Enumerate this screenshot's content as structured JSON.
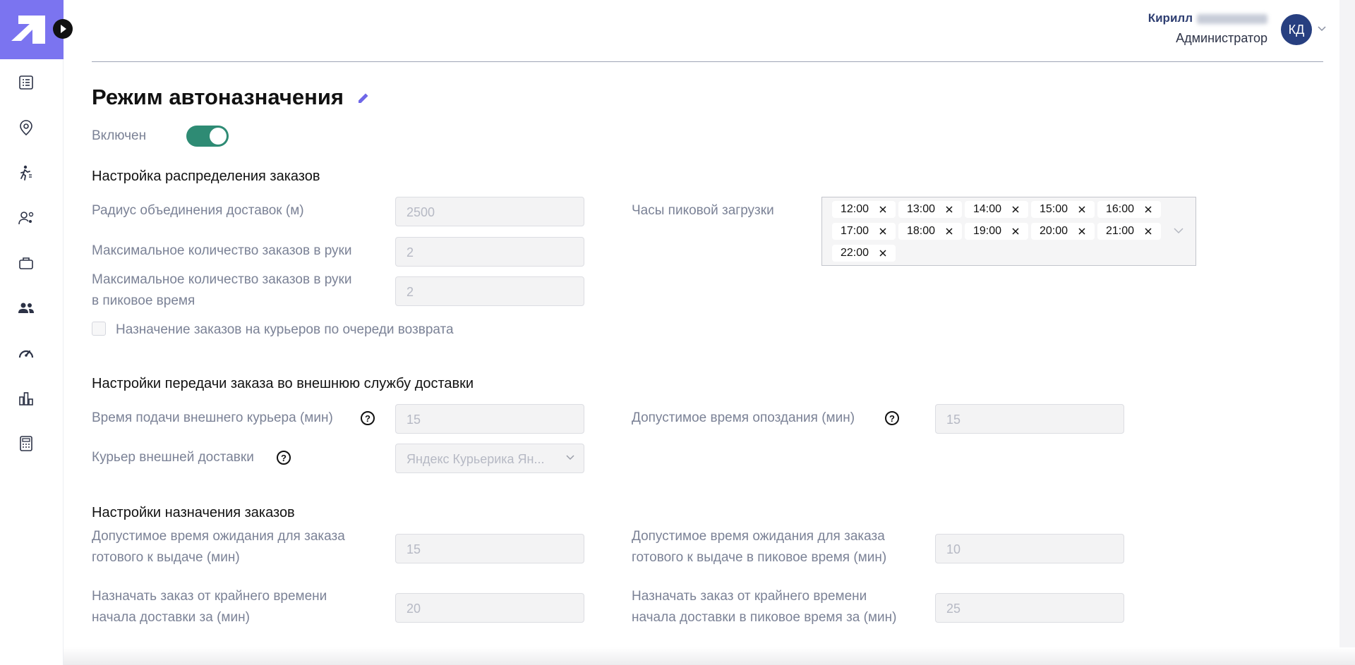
{
  "header": {
    "user_first_name": "Кирилл",
    "user_role": "Администратор",
    "avatar_initials": "КД"
  },
  "sidebar": {
    "icons": [
      "list-icon",
      "location-pin-icon",
      "courier-running-icon",
      "user-settings-icon",
      "briefcase-icon",
      "users-group-icon",
      "speedometer-icon",
      "bar-chart-icon",
      "calculator-icon"
    ]
  },
  "page": {
    "title": "Режим автоназначения",
    "toggle_label": "Включен",
    "toggle_on": true
  },
  "distribution": {
    "title": "Настройка распределения заказов",
    "radius_label": "Радиус объединения доставок (м)",
    "radius_value": "2500",
    "max_orders_label": "Максимальное количество заказов в руки",
    "max_orders_value": "2",
    "max_orders_peak_label_1": "Максимальное количество заказов в руки",
    "max_orders_peak_label_2": "в пиковое время",
    "max_orders_peak_value": "2",
    "return_queue_label": "Назначение заказов на курьеров по очереди возврата",
    "peak_hours_label": "Часы пиковой загрузки",
    "peak_hours": [
      "12:00",
      "13:00",
      "14:00",
      "15:00",
      "16:00",
      "17:00",
      "18:00",
      "19:00",
      "20:00",
      "21:00",
      "22:00"
    ]
  },
  "external": {
    "title": "Настройки передачи заказа во внешнюю службу доставки",
    "courier_time_label": "Время подачи внешнего курьера (мин)",
    "courier_time_value": "15",
    "delay_label": "Допустимое время опоздания (мин)",
    "delay_value": "15",
    "courier_label": "Курьер внешней доставки",
    "courier_value": "Яндекс Курьерика Ян..."
  },
  "assignment": {
    "title": "Настройки назначения заказов",
    "wait_label_1": "Допустимое время ожидания для заказа",
    "wait_label_2": "готового к выдаче (мин)",
    "wait_value": "15",
    "wait_peak_label_1": "Допустимое время ожидания для заказа",
    "wait_peak_label_2": "готового к выдаче в пиковое время (мин)",
    "wait_peak_value": "10",
    "deadline_label_1": "Назначать заказ от крайнего времени",
    "deadline_label_2": "начала доставки за (мин)",
    "deadline_value": "20",
    "deadline_peak_label_1": "Назначать заказ от крайнего времени",
    "deadline_peak_label_2": "начала доставки в пиковое время за (мин)",
    "deadline_peak_value": "25"
  }
}
